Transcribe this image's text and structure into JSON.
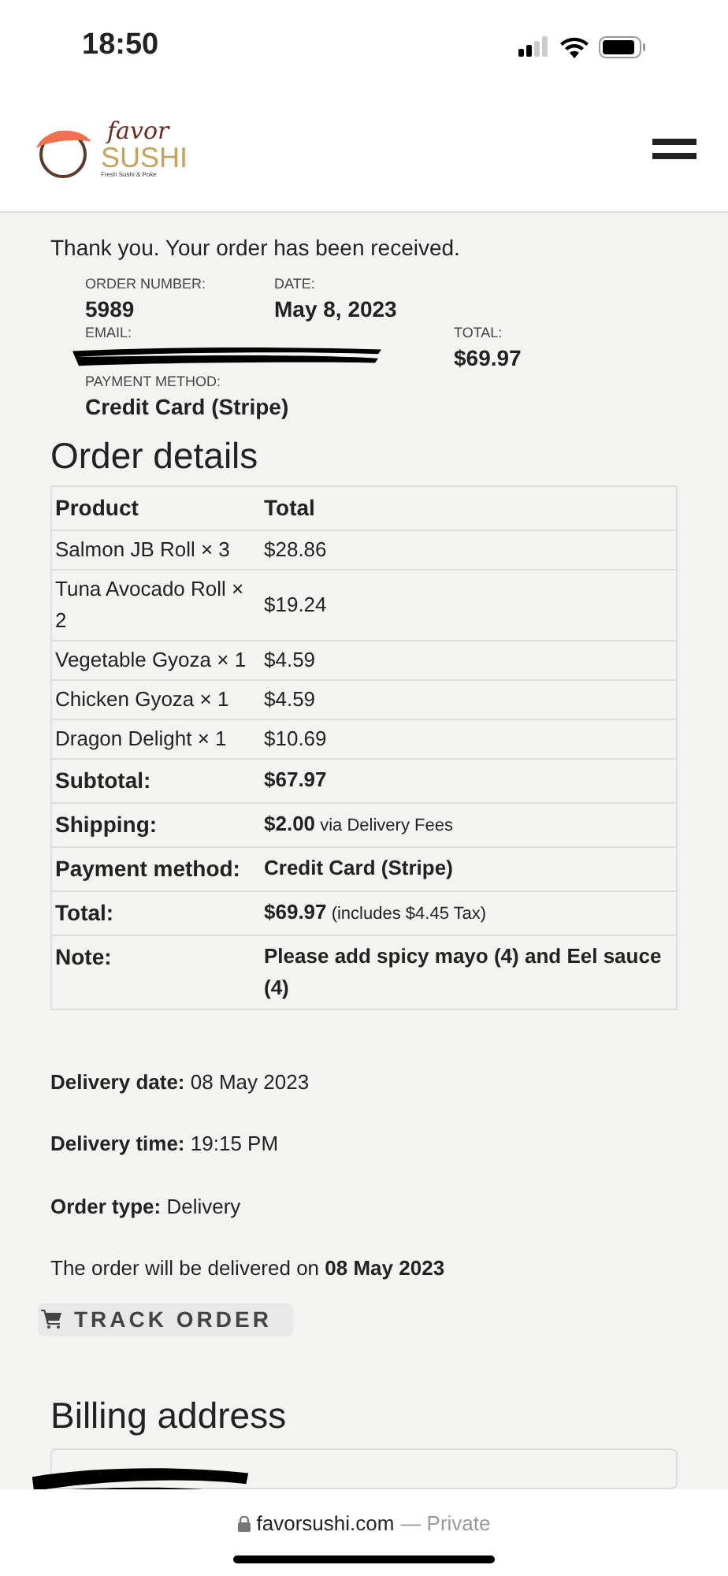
{
  "status_bar": {
    "time": "18:50"
  },
  "header": {
    "logo": {
      "script": "favor",
      "word": "SUSHI",
      "tagline": "Fresh Sushi & Poke"
    }
  },
  "notice": "Thank you. Your order has been received.",
  "overview": [
    {
      "kind": "cell",
      "label": "ORDER NUMBER:",
      "value": "5989"
    },
    {
      "kind": "cell",
      "label": "DATE:",
      "value": "May 8, 2023"
    },
    {
      "kind": "wide",
      "label": "EMAIL:",
      "redacted": true
    },
    {
      "kind": "cell",
      "label": "TOTAL:",
      "value": "$69.97"
    },
    {
      "kind": "full",
      "label": "PAYMENT METHOD:",
      "value": "Credit Card (Stripe)"
    }
  ],
  "order_details": {
    "title": "Order details",
    "columns": [
      "Product",
      "Total"
    ],
    "items": [
      {
        "product": "Salmon JB Roll × 3",
        "total": "$28.86"
      },
      {
        "product": "Tuna Avocado Roll × 2",
        "total": "$19.24"
      },
      {
        "product": "Vegetable Gyoza × 1",
        "total": "$4.59"
      },
      {
        "product": "Chicken Gyoza × 1",
        "total": "$4.59"
      },
      {
        "product": "Dragon Delight × 1",
        "total": "$10.69"
      }
    ],
    "totals": [
      {
        "label": "Subtotal:",
        "value": "$67.97"
      },
      {
        "label": "Shipping:",
        "value": "$2.00",
        "note": "via Delivery Fees"
      },
      {
        "label": "Payment method:",
        "value": "Credit Card (Stripe)"
      },
      {
        "label": "Total:",
        "value": "$69.97",
        "note": "(includes $4.45 Tax)"
      },
      {
        "label": "Note:",
        "value": "Please add spicy mayo (4) and Eel sauce (4)"
      }
    ]
  },
  "delivery": [
    {
      "label": "Delivery date:",
      "value": "08 May 2023"
    },
    {
      "label": "Delivery time:",
      "value": "19:15 PM"
    },
    {
      "label": "Order type:",
      "value": "Delivery"
    }
  ],
  "delivery_sentence": "The order will be delivered on **08 May 2023**",
  "track_button": "TRACK ORDER",
  "billing": {
    "title": "Billing address",
    "redacted": true
  },
  "browser_bar": {
    "domain": "favorsushi.com",
    "mode": "— Private"
  }
}
